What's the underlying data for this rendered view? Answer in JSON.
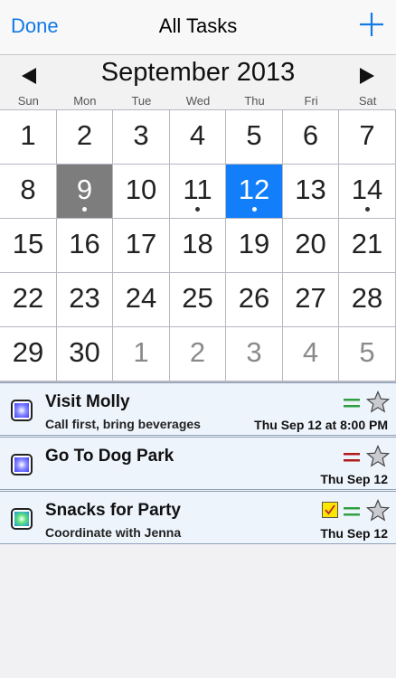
{
  "navbar": {
    "done_label": "Done",
    "title": "All Tasks",
    "add_icon": "plus-icon",
    "accent": "#1279e6"
  },
  "calendar": {
    "month_title": "September 2013",
    "weekdays": [
      "Sun",
      "Mon",
      "Tue",
      "Wed",
      "Thu",
      "Fri",
      "Sat"
    ],
    "weeks": [
      [
        {
          "n": "1"
        },
        {
          "n": "2"
        },
        {
          "n": "3"
        },
        {
          "n": "4"
        },
        {
          "n": "5"
        },
        {
          "n": "6"
        },
        {
          "n": "7"
        }
      ],
      [
        {
          "n": "8"
        },
        {
          "n": "9",
          "today": true,
          "dot": true
        },
        {
          "n": "10"
        },
        {
          "n": "11",
          "dot": true
        },
        {
          "n": "12",
          "selected": true,
          "dot": true
        },
        {
          "n": "13"
        },
        {
          "n": "14",
          "dot": true
        }
      ],
      [
        {
          "n": "15"
        },
        {
          "n": "16"
        },
        {
          "n": "17"
        },
        {
          "n": "18"
        },
        {
          "n": "19"
        },
        {
          "n": "20"
        },
        {
          "n": "21"
        }
      ],
      [
        {
          "n": "22"
        },
        {
          "n": "23"
        },
        {
          "n": "24"
        },
        {
          "n": "25"
        },
        {
          "n": "26"
        },
        {
          "n": "27"
        },
        {
          "n": "28"
        }
      ],
      [
        {
          "n": "29"
        },
        {
          "n": "30"
        },
        {
          "n": "1",
          "other": true
        },
        {
          "n": "2",
          "other": true
        },
        {
          "n": "3",
          "other": true
        },
        {
          "n": "4",
          "other": true
        },
        {
          "n": "5",
          "other": true
        }
      ]
    ],
    "today_color": "#7d7d7d",
    "selected_color": "#127ef9"
  },
  "tasks": [
    {
      "title": "Visit Molly",
      "note": "Call first, bring beverages",
      "date": "Thu Sep 12 at 8:00 PM",
      "priority_color": "#2ea043",
      "check_style": "blue",
      "flag": false
    },
    {
      "title": "Go To Dog Park",
      "note": "",
      "date": "Thu Sep 12",
      "priority_color": "#b01c1c",
      "check_style": "blue",
      "flag": false
    },
    {
      "title": "Snacks for Party",
      "note": "Coordinate with Jenna",
      "date": "Thu Sep 12",
      "priority_color": "#2ea043",
      "check_style": "green",
      "flag": true
    }
  ]
}
